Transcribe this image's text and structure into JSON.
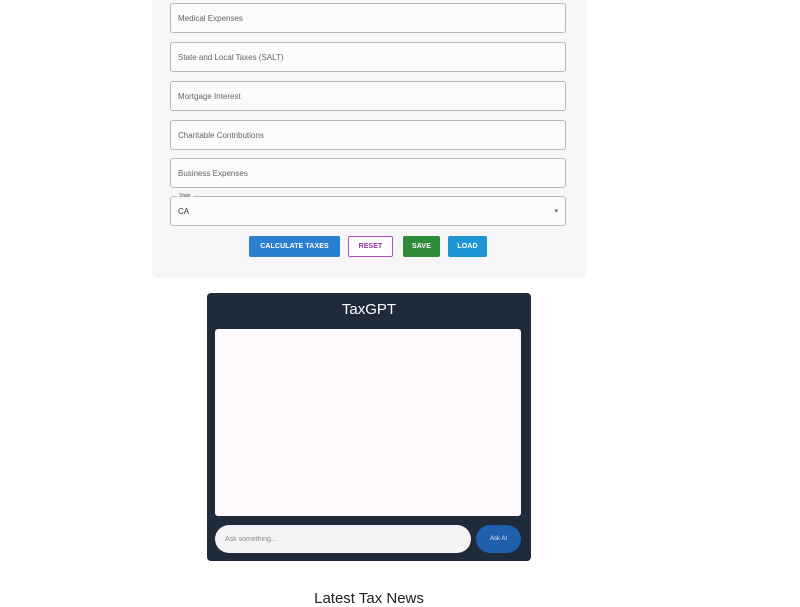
{
  "form": {
    "fields": [
      {
        "placeholder": "Medical Expenses"
      },
      {
        "placeholder": "State and Local Taxes (SALT)"
      },
      {
        "placeholder": "Mortgage Interest"
      },
      {
        "placeholder": "Charitable Contributions"
      },
      {
        "placeholder": "Business Expenses"
      }
    ],
    "state": {
      "label": "State",
      "value": "CA"
    },
    "buttons": {
      "calculate": "Calculate Taxes",
      "reset": "Reset",
      "save": "Save",
      "load": "Load"
    }
  },
  "chat": {
    "title": "TaxGPT",
    "input_placeholder": "Ask something...",
    "ask_label": "Ask AI"
  },
  "news": {
    "heading": "Latest Tax News"
  },
  "colors": {
    "chat_bg": "#1f2a3b",
    "calculate": "#2b7fd0",
    "reset": "#9b2ea8",
    "save": "#2e8b3a",
    "load": "#1e95d4",
    "ask": "#1e5fae"
  }
}
